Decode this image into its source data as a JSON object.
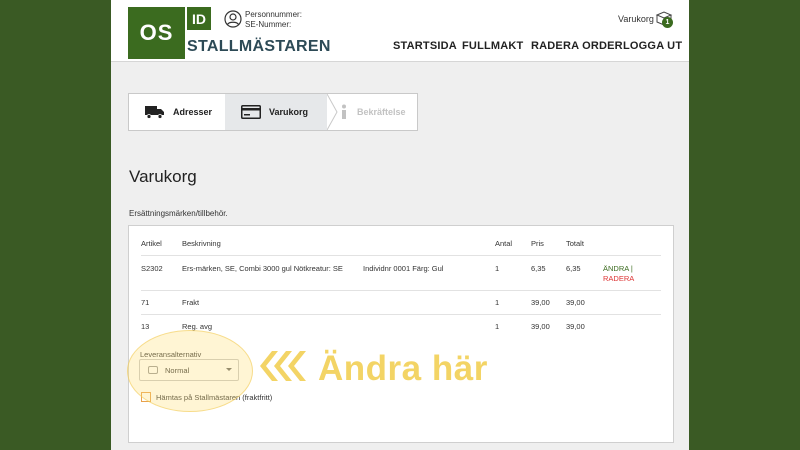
{
  "header": {
    "logo_os": "OS",
    "logo_id": "ID",
    "brand": "STALLMÄSTAREN",
    "person_line1": "Personnummer:",
    "person_line2": "SE-Nummer:",
    "cart_label": "Varukorg",
    "cart_count": "1",
    "nav": [
      "STARTSIDA",
      "FULLMAKT",
      "RADERA ORDER",
      "LOGGA UT"
    ]
  },
  "steps": [
    {
      "label": "Adresser",
      "icon": "truck-icon",
      "state": "done"
    },
    {
      "label": "Varukorg",
      "icon": "card-icon",
      "state": "active"
    },
    {
      "label": "Bekräftelse",
      "icon": "info-icon",
      "state": "disabled"
    }
  ],
  "page": {
    "title": "Varukorg",
    "section_label": "Ersättningsmärken/tillbehör."
  },
  "table": {
    "headers": [
      "Artikel",
      "Beskrivning",
      "Antal",
      "Pris",
      "Totalt"
    ],
    "rows": [
      {
        "artikel": "S2302",
        "beskrivning": "Ers-märken, SE, Combi 3000 gul Nötkreatur: SE",
        "extra": "Individnr 0001 Färg: Gul",
        "antal": "1",
        "pris": "6,35",
        "totalt": "6,35",
        "change": "ÄNDRA |",
        "delete": "RADERA"
      },
      {
        "artikel": "71",
        "beskrivning": "Frakt",
        "extra": "",
        "antal": "1",
        "pris": "39,00",
        "totalt": "39,00",
        "change": "",
        "delete": ""
      },
      {
        "artikel": "13",
        "beskrivning": "Reg. avg",
        "extra": "",
        "antal": "1",
        "pris": "39,00",
        "totalt": "39,00",
        "change": "",
        "delete": ""
      }
    ]
  },
  "delivery": {
    "label": "Leveransalternativ",
    "selected": "Normal",
    "pickup_label": "Hämtas på Stallmästaren (fraktfritt)"
  },
  "annotation": {
    "text": "Ändra här"
  },
  "colors": {
    "brand_green": "#3b6b1f",
    "background_outer": "#3a5a24",
    "callout_yellow": "#f3d465",
    "delete_red": "#d33"
  }
}
